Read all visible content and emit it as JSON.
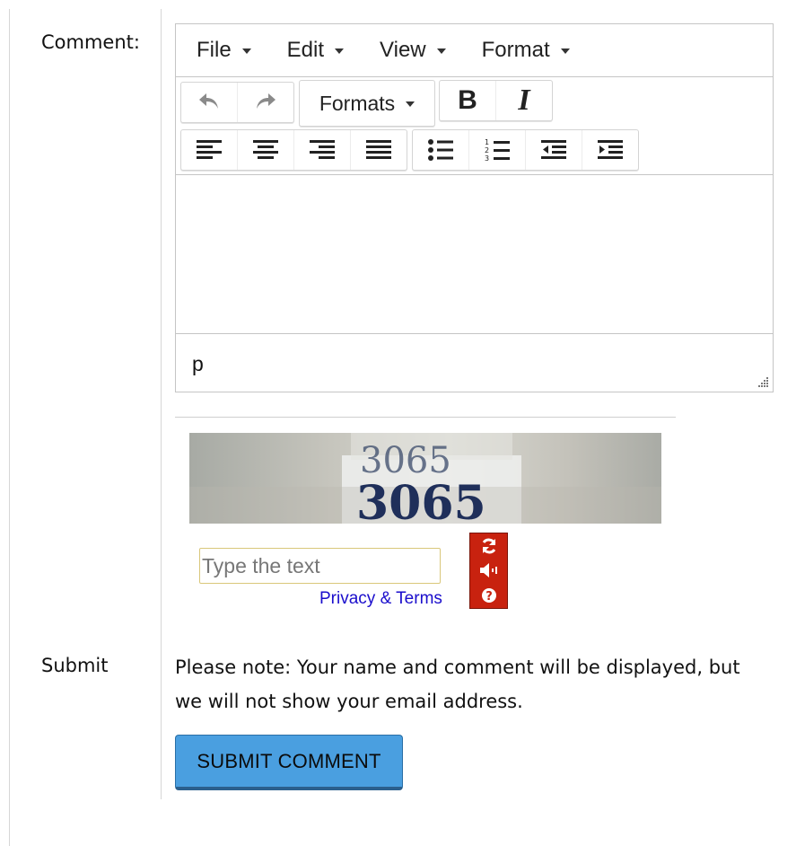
{
  "form": {
    "comment_label": "Comment:",
    "submit_label": "Submit"
  },
  "editor": {
    "menus": [
      "File",
      "Edit",
      "View",
      "Format"
    ],
    "formats_label": "Formats",
    "bold_glyph": "B",
    "italic_glyph": "I",
    "toolbar_icons": {
      "history": [
        "undo-icon",
        "redo-icon"
      ],
      "align": [
        "align-left-icon",
        "align-center-icon",
        "align-right-icon",
        "align-justify-icon"
      ],
      "lists": [
        "bullet-list-icon",
        "numbered-list-icon",
        "outdent-icon",
        "indent-icon"
      ]
    },
    "content": "",
    "path": "p"
  },
  "captcha": {
    "image_text": "3065",
    "input_placeholder": "Type the text",
    "input_value": "",
    "privacy_link": "Privacy & Terms",
    "controls": [
      "refresh-icon",
      "audio-icon",
      "help-icon"
    ],
    "control_color": "#c8220f"
  },
  "note": "Please note: Your name and comment will be displayed, but we will not show your email address.",
  "submit_button": "SUBMIT COMMENT",
  "colors": {
    "button": "#4a9fe0",
    "link": "#1a0dcc"
  }
}
